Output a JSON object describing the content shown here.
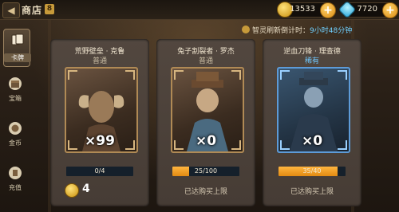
{
  "header": {
    "back_icon": "back-arrow-icon",
    "title": "商店",
    "title_badge": "8"
  },
  "currencies": [
    {
      "icon": "gold-coin-icon",
      "color": "#f5c443",
      "amount": "13533"
    },
    {
      "icon": "blue-gem-icon",
      "color": "#4fd6ff",
      "amount": "7720"
    }
  ],
  "refresh": {
    "label": "智灵刷新倒计时：",
    "time": "9小时48分钟"
  },
  "sidebar": {
    "items": [
      {
        "label": "卡牌",
        "icon": "cards-icon",
        "active": true
      },
      {
        "label": "宝箱",
        "icon": "chest-icon",
        "active": false
      },
      {
        "label": "金币",
        "icon": "coin-icon",
        "active": false
      },
      {
        "label": "充值",
        "icon": "recharge-icon",
        "active": false
      }
    ]
  },
  "cards": [
    {
      "name": "荒野壁垒 · 克鲁",
      "rarity": "普通",
      "rarity_color": "#c9bda4",
      "quantity": "×99",
      "progress_text": "0/4",
      "progress": 0.0,
      "price": "4",
      "limit_text": ""
    },
    {
      "name": "兔子割裂者 · 罗杰",
      "rarity": "普通",
      "rarity_color": "#c9bda4",
      "quantity": "×0",
      "progress_text": "25/100",
      "progress": 0.25,
      "price": "",
      "limit_text": "已达购买上限"
    },
    {
      "name": "逆血刀锋 · 理查德",
      "rarity": "稀有",
      "rarity_color": "#6fc8ff",
      "quantity": "×0",
      "progress_text": "35/40",
      "progress": 0.875,
      "price": "",
      "limit_text": "已达购买上限"
    }
  ]
}
